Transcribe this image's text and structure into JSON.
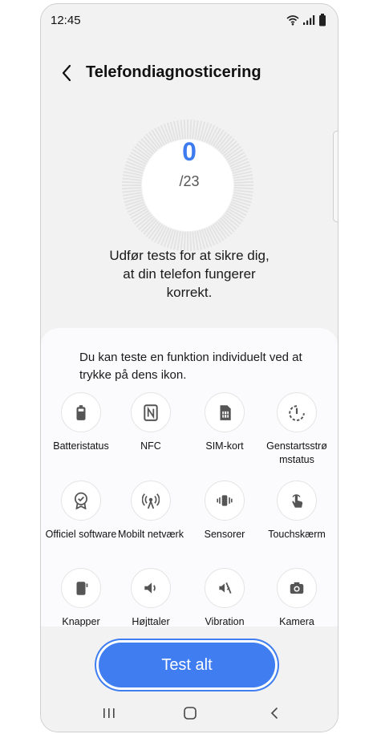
{
  "status_bar": {
    "time": "12:45"
  },
  "header": {
    "title": "Telefondiagnosticering"
  },
  "progress": {
    "completed": "0",
    "total_label": "/23",
    "done": 0,
    "total": 23
  },
  "intro_text": "Udfør tests for at sikre dig, at din telefon fungerer korrekt.",
  "panel": {
    "hint": "Du kan teste en funktion individuelt ved at trykke på dens ikon.",
    "tests": [
      {
        "label": "Batteristatus",
        "icon": "battery-icon"
      },
      {
        "label": "NFC",
        "icon": "nfc-icon"
      },
      {
        "label": "SIM-kort",
        "icon": "sim-card-icon"
      },
      {
        "label": "Genstartsstrø mstatus",
        "icon": "restart-icon"
      },
      {
        "label": "Officiel software",
        "icon": "certified-badge-icon"
      },
      {
        "label": "Mobilt netværk",
        "icon": "cell-tower-icon"
      },
      {
        "label": "Sensorer",
        "icon": "sensor-icon"
      },
      {
        "label": "Touchskærm",
        "icon": "touch-icon"
      },
      {
        "label": "Knapper",
        "icon": "side-button-icon"
      },
      {
        "label": "Højttaler",
        "icon": "speaker-icon"
      },
      {
        "label": "Vibration",
        "icon": "vibration-icon"
      },
      {
        "label": "Kamera",
        "icon": "camera-icon"
      }
    ]
  },
  "actions": {
    "test_all": "Test alt"
  },
  "colors": {
    "accent": "#3f7df0",
    "background": "#f2f2f2",
    "icon": "#555555"
  }
}
